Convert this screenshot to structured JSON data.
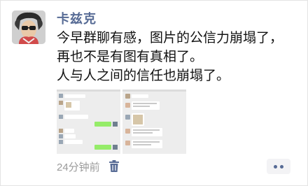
{
  "moment": {
    "author": "卡兹克",
    "lines": [
      "今早群聊有感，图片的公信力崩塌了，",
      "再也不是有图有真相了。",
      "人与人之间的信任也崩塌了。"
    ],
    "timestamp": "24分钟前"
  },
  "icons": {
    "avatar": "avatar-image",
    "delete": "trash-icon",
    "more": "more-dots-icon"
  },
  "colors": {
    "nickname": "#576b95",
    "meta": "#9b9b9b",
    "accent": "#576b95",
    "chat_bubble_green": "#95ec69"
  }
}
